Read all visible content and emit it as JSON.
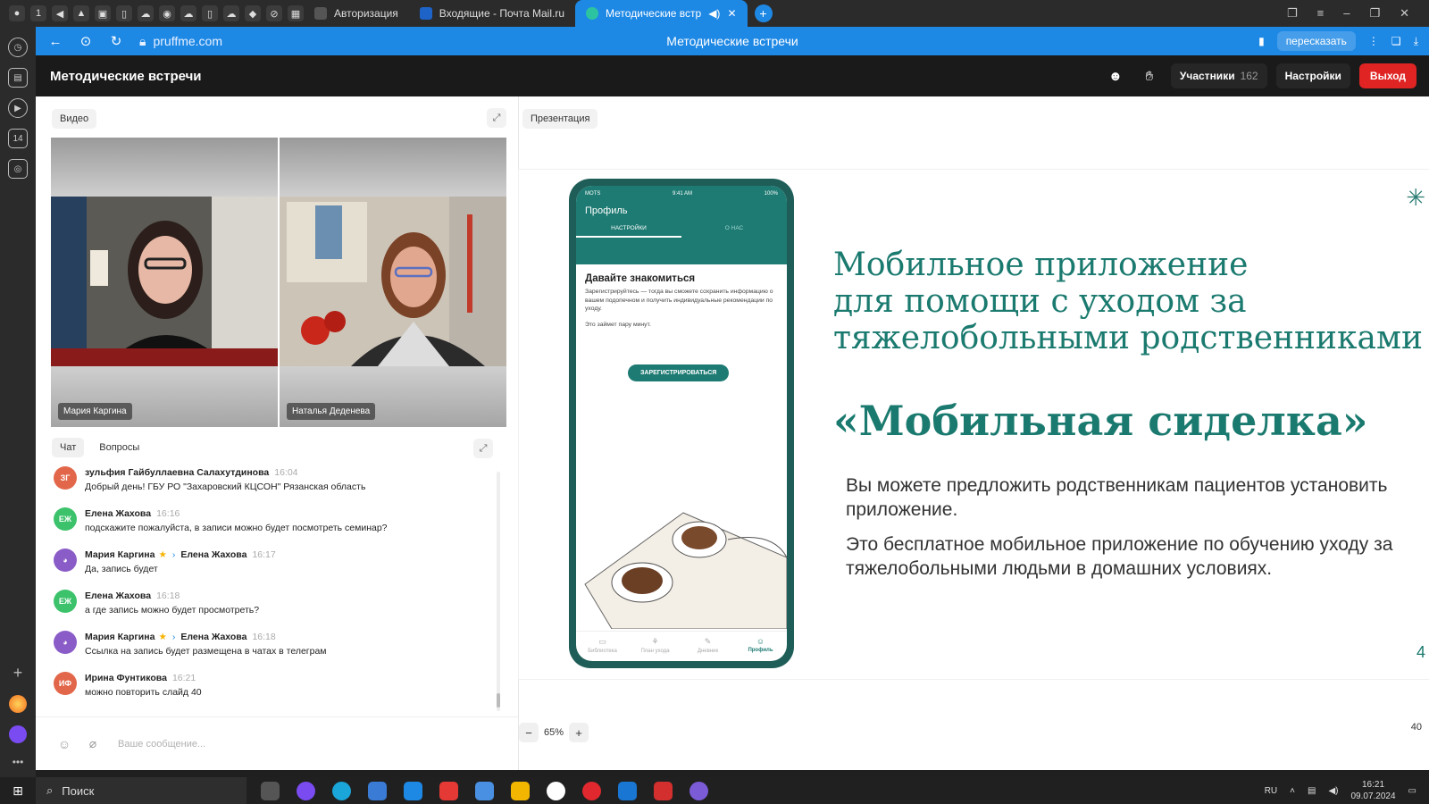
{
  "browser": {
    "tab_counter": "1",
    "tabs": [
      {
        "label": "Авторизация",
        "active": false
      },
      {
        "label": "Входящие - Почта Mail.ru",
        "active": false
      },
      {
        "label": "Методические встр",
        "active": true
      }
    ],
    "url": "pruffme.com",
    "page_title": "Методические встречи",
    "retell_label": "пересказать"
  },
  "sidebar": {
    "badge": "14"
  },
  "meeting": {
    "title": "Методические встречи",
    "participants_label": "Участники",
    "participants_count": "162",
    "settings_label": "Настройки",
    "exit_label": "Выход"
  },
  "video": {
    "label": "Видео",
    "participants": [
      {
        "name": "Мария Каргина",
        "speaking": false
      },
      {
        "name": "Наталья Деденева",
        "speaking": true
      }
    ]
  },
  "chat": {
    "tabs": [
      {
        "label": "Чат",
        "active": true
      },
      {
        "label": "Вопросы",
        "active": false
      }
    ],
    "messages": [
      {
        "initials": "ЗГ",
        "color": "#e2674a",
        "author": "зульфия Гайбуллаевна Салахутдинова",
        "time": "16:04",
        "text": "Добрый день! ГБУ РО \"Захаровский КЦСОН\" Рязанская область"
      },
      {
        "initials": "ЕЖ",
        "color": "#3cc26b",
        "author": "Елена Жахова",
        "time": "16:16",
        "text": "подскажите пожалуйста, в записи можно будет посмотреть семинар?"
      },
      {
        "initials": "",
        "color": "#8a5cc7",
        "author": "Мария Каргина",
        "recipient": "Елена Жахова",
        "time": "16:17",
        "text": "Да, запись будет"
      },
      {
        "initials": "ЕЖ",
        "color": "#3cc26b",
        "author": "Елена Жахова",
        "time": "16:18",
        "text": "а где запись можно будет просмотреть?"
      },
      {
        "initials": "",
        "color": "#8a5cc7",
        "author": "Мария Каргина",
        "recipient": "Елена Жахова",
        "time": "16:18",
        "text": "Ссылка на запись будет размещена в чатах в телеграм"
      },
      {
        "initials": "ИФ",
        "color": "#e2674a",
        "author": "Ирина Фунтикова",
        "time": "16:21",
        "text": "можно повторить слайд 40"
      }
    ],
    "input_placeholder": "Ваше сообщение..."
  },
  "presentation": {
    "label": "Презентация",
    "zoom": "65%",
    "page": "40",
    "slide": {
      "heading_lines": [
        "Мобильное приложение",
        "для помощи с уходом за",
        "тяжелобольными родственниками"
      ],
      "app_name": "«Мобильная сиделка»",
      "paragraph1": "Вы можете предложить родственникам пациентов установить приложение.",
      "paragraph2": "Это бесплатное мобильное приложение по обучению уходу за тяжелобольными людьми в домашних условиях.",
      "slide_number": "4",
      "phone": {
        "carrier": "MOTS",
        "time": "9:41 AM",
        "battery": "100%",
        "title": "Профиль",
        "tab_active": "НАСТРОЙКИ",
        "tab_inactive": "О НАС",
        "heading": "Давайте знакомиться",
        "text": "Зарегистрируйтесь — тогда вы сможете сохранить информацию о вашем подопечном и получить индивидуальные рекомендации по уходу.",
        "note": "Это займет пару минут.",
        "button": "ЗАРЕГИСТРИРОВАТЬСЯ",
        "nav": [
          "Библиотека",
          "План ухода",
          "Дневник",
          "Профиль"
        ]
      }
    }
  },
  "taskbar": {
    "search_label": "Поиск",
    "lang": "RU",
    "time": "16:21",
    "date": "09.07.2024"
  }
}
